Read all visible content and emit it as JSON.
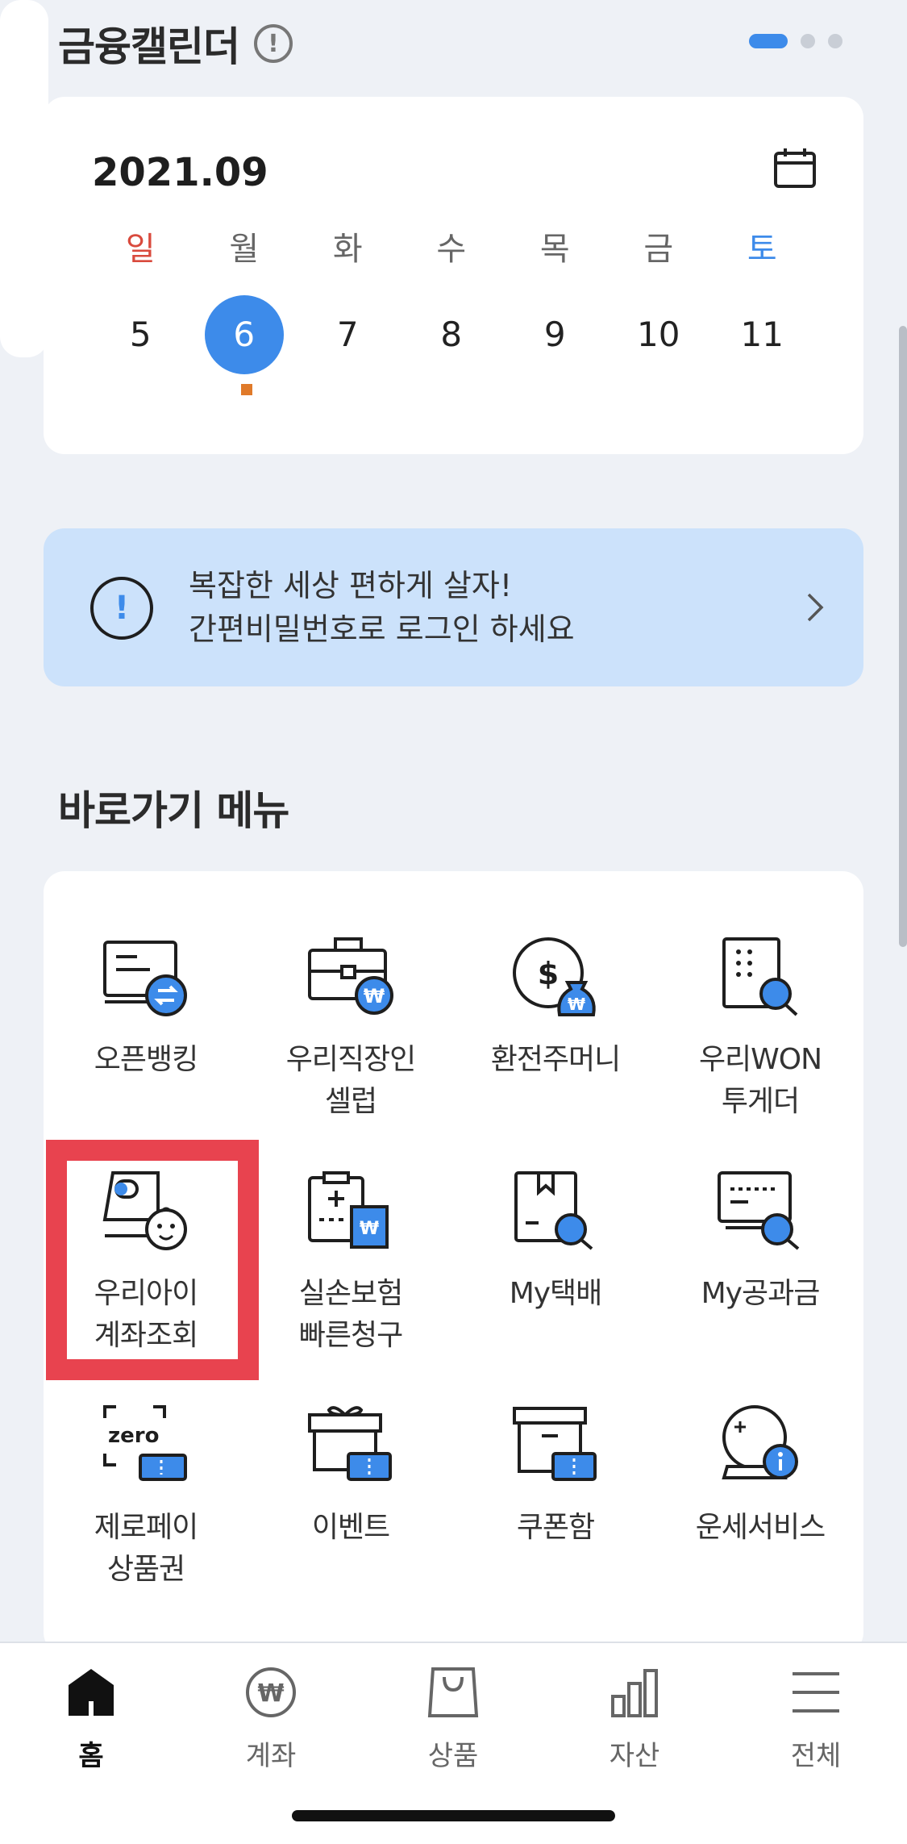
{
  "calendar_section": {
    "title": "금융캘린더",
    "info_icon": "info-icon",
    "month": "2021.09",
    "weekdays": [
      {
        "label": "일",
        "color": "#d94a3d"
      },
      {
        "label": "월",
        "color": "#666666"
      },
      {
        "label": "화",
        "color": "#666666"
      },
      {
        "label": "수",
        "color": "#666666"
      },
      {
        "label": "목",
        "color": "#666666"
      },
      {
        "label": "금",
        "color": "#666666"
      },
      {
        "label": "토",
        "color": "#3d8bea"
      }
    ],
    "days": [
      "5",
      "6",
      "7",
      "8",
      "9",
      "10",
      "11"
    ],
    "selected_day": "6"
  },
  "banner": {
    "line1": "복잡한 세상 편하게 살자!",
    "line2": "간편비밀번호로 로그인 하세요",
    "icon": "!"
  },
  "shortcut_section": {
    "title": "바로가기 메뉴",
    "items": [
      {
        "line1": "오픈뱅킹",
        "line2": ""
      },
      {
        "line1": "우리직장인",
        "line2": "셀럽"
      },
      {
        "line1": "환전주머니",
        "line2": ""
      },
      {
        "line1": "우리WON",
        "line2": "투게더"
      },
      {
        "line1": "우리아이",
        "line2": "계좌조회"
      },
      {
        "line1": "실손보험",
        "line2": "빠른청구"
      },
      {
        "line1": "My택배",
        "line2": ""
      },
      {
        "line1": "My공과금",
        "line2": ""
      },
      {
        "line1": "제로페이",
        "line2": "상품권"
      },
      {
        "line1": "이벤트",
        "line2": ""
      },
      {
        "line1": "쿠폰함",
        "line2": ""
      },
      {
        "line1": "운세서비스",
        "line2": ""
      }
    ]
  },
  "bottom_nav": {
    "items": [
      {
        "label": "홈",
        "active": true
      },
      {
        "label": "계좌",
        "active": false
      },
      {
        "label": "상품",
        "active": false
      },
      {
        "label": "자산",
        "active": false
      },
      {
        "label": "전체",
        "active": false
      }
    ]
  },
  "colors": {
    "accent": "#3d8bea",
    "highlight": "#e8434f",
    "banner_bg": "#cce2fb",
    "event_marker": "#e07a2a"
  }
}
